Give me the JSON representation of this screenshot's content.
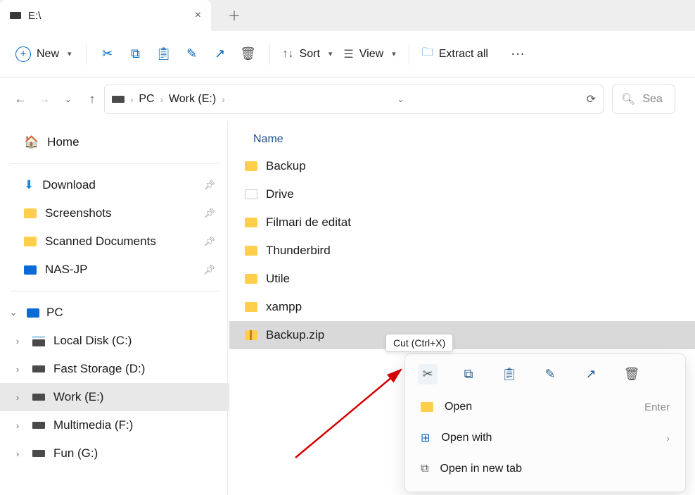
{
  "tab": {
    "title": "E:\\"
  },
  "toolbar": {
    "new_label": "New",
    "sort_label": "Sort",
    "view_label": "View",
    "extract_label": "Extract all"
  },
  "breadcrumb": {
    "root": "PC",
    "drive": "Work (E:)"
  },
  "search": {
    "placeholder": "Sea"
  },
  "sidebar": {
    "home": "Home",
    "quick": [
      {
        "label": "Download"
      },
      {
        "label": "Screenshots"
      },
      {
        "label": "Scanned Documents"
      },
      {
        "label": "NAS-JP"
      }
    ],
    "pc_label": "PC",
    "drives": [
      {
        "label": "Local Disk (C:)"
      },
      {
        "label": "Fast Storage (D:)"
      },
      {
        "label": "Work (E:)"
      },
      {
        "label": "Multimedia (F:)"
      },
      {
        "label": "Fun (G:)"
      }
    ]
  },
  "columns": {
    "name": "Name"
  },
  "items": [
    {
      "label": "Backup"
    },
    {
      "label": "Drive"
    },
    {
      "label": "Filmari de editat"
    },
    {
      "label": "Thunderbird"
    },
    {
      "label": "Utile"
    },
    {
      "label": "xampp"
    },
    {
      "label": "Backup.zip"
    }
  ],
  "tooltip": {
    "cut": "Cut (Ctrl+X)"
  },
  "context_menu": {
    "open": "Open",
    "open_hint": "Enter",
    "open_with": "Open with",
    "open_new_tab": "Open in new tab"
  }
}
